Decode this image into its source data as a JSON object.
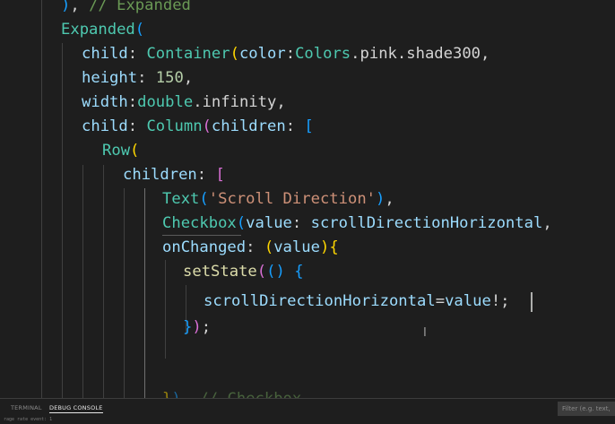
{
  "editor": {
    "lines": [
      {
        "text": "), // Expanded"
      },
      {
        "text": "Expanded("
      },
      {
        "text": "child: Container(color:Colors.pink.shade300,"
      },
      {
        "text": "height: 150,"
      },
      {
        "text": "width:double.infinity,"
      },
      {
        "text": "child: Column(children: ["
      },
      {
        "text": "Row("
      },
      {
        "text": "children: ["
      },
      {
        "text": "Text('Scroll Direction'),"
      },
      {
        "text": "Checkbox(value: scrollDirectionHorizontal,"
      },
      {
        "text": "onChanged: (value){"
      },
      {
        "text": "setState(() {"
      },
      {
        "text": "scrollDirectionHorizontal=value!;"
      },
      {
        "text": "});"
      },
      {
        "text": ""
      },
      {
        "text": ""
      },
      {
        "text": "}), // Checkbox"
      }
    ]
  },
  "panel": {
    "tabs": [
      {
        "label": "TERMINAL",
        "active": false
      },
      {
        "label": "DEBUG CONSOLE",
        "active": true
      }
    ],
    "sub_text": "rage rate event: 1",
    "filter_placeholder": "Filter (e.g. text, !exclude)"
  },
  "colors": {
    "background": "#1e1e1e",
    "type": "#4ec9b0",
    "property": "#9cdcfe",
    "number": "#b5cea8",
    "string": "#ce9178",
    "function": "#dcdcaa",
    "comment": "#6a9955",
    "bracket_level1": "#ffd700",
    "bracket_level2": "#da70d6",
    "bracket_level3": "#179fff"
  }
}
